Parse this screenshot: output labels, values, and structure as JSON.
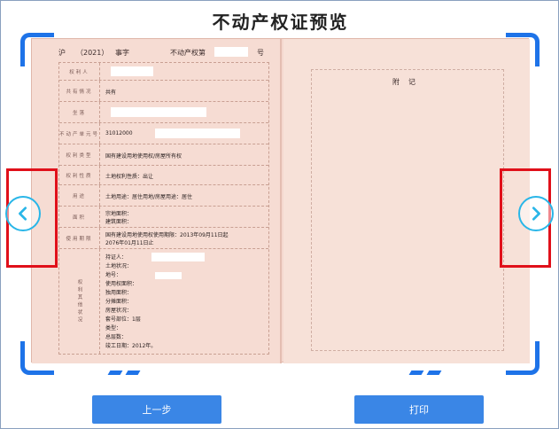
{
  "title": "不动产权证预览",
  "certificate": {
    "header_prefix": "沪",
    "header_year": "（2021）",
    "header_type": "事字",
    "header_num_label": "不动产权第",
    "header_suffix": "号",
    "rows": [
      {
        "label": "权利人",
        "value": ""
      },
      {
        "label": "共有情况",
        "value": "共有"
      },
      {
        "label": "坐落",
        "value": ""
      },
      {
        "label": "不动产单元号",
        "value": "31012000"
      },
      {
        "label": "权利类型",
        "value": "国有建设用地使用权/房屋所有权"
      },
      {
        "label": "权利性质",
        "value": "土地权利性质：出让"
      },
      {
        "label": "用途",
        "value": "土地用途：居住用地/房屋用途：居住"
      },
      {
        "label": "面积",
        "value_lines": [
          "宗地面积：",
          "建筑面积："
        ]
      },
      {
        "label": "使用期限",
        "value_lines": [
          "国有建设用地使用权使用期限：2013年09月11日起",
          "2076年01月11日止"
        ]
      },
      {
        "label": "权利其他状况",
        "value_lines": [
          "持证人：",
          "土地状况：",
          "地号：",
          "使用权面积：",
          "独用面积：",
          "分摊面积：",
          "房屋状况：",
          "套号部位：1层",
          "类型：",
          "总层数：",
          "竣工日期：2012年。"
        ]
      }
    ],
    "appendix_title": "附记"
  },
  "nav": {
    "left_icon": "chevron-left-icon",
    "right_icon": "chevron-right-icon"
  },
  "buttons": {
    "prev_label": "上一步",
    "print_label": "打印"
  },
  "colors": {
    "accent": "#1e73e8",
    "button": "#3a86e6",
    "highlight": "#e0101a",
    "nav_circle": "#29b6e8"
  }
}
